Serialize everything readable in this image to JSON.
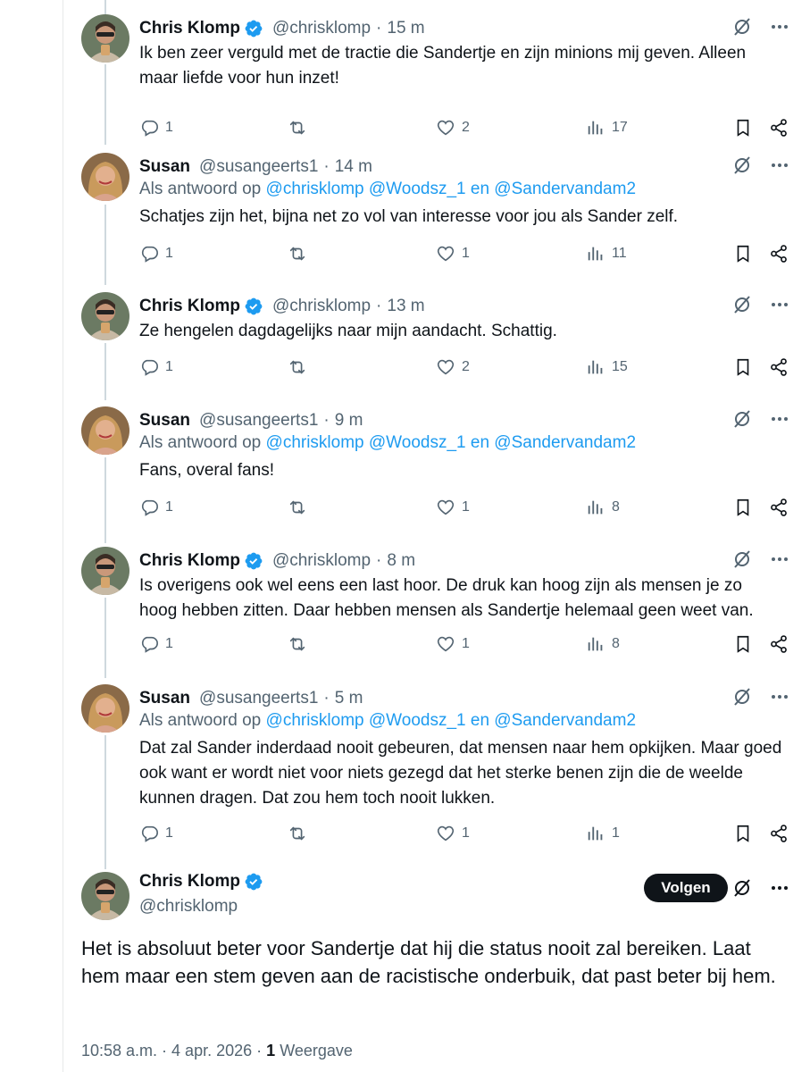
{
  "colors": {
    "accent": "#1d9bf0",
    "text": "#0f1419",
    "muted": "#536471"
  },
  "replies": [
    {
      "name": "Chris Klomp",
      "verified": true,
      "handle": "@chrisklomp",
      "time": "15 m",
      "reply_to": null,
      "text": "Ik ben zeer verguld met de tractie die Sandertje en zijn minions mij geven. Alleen maar liefde voor hun inzet!",
      "replies": "1",
      "reposts": "",
      "likes": "2",
      "views": "17"
    },
    {
      "name": "Susan",
      "verified": false,
      "handle": "@susangeerts1",
      "time": "14 m",
      "reply_to": {
        "prefix": "Als antwoord op",
        "mentions": "@chrisklomp @Woodsz_1 en @Sandervandam2"
      },
      "text": "Schatjes zijn het, bijna net zo vol van interesse voor jou als Sander zelf.",
      "replies": "1",
      "reposts": "",
      "likes": "1",
      "views": "11"
    },
    {
      "name": "Chris Klomp",
      "verified": true,
      "handle": "@chrisklomp",
      "time": "13 m",
      "reply_to": null,
      "text": "Ze hengelen dagdagelijks naar mijn aandacht. Schattig.",
      "replies": "1",
      "reposts": "",
      "likes": "2",
      "views": "15"
    },
    {
      "name": "Susan",
      "verified": false,
      "handle": "@susangeerts1",
      "time": "9 m",
      "reply_to": {
        "prefix": "Als antwoord op",
        "mentions": "@chrisklomp @Woodsz_1 en @Sandervandam2"
      },
      "text": "Fans, overal fans!",
      "replies": "1",
      "reposts": "",
      "likes": "1",
      "views": "8"
    },
    {
      "name": "Chris Klomp",
      "verified": true,
      "handle": "@chrisklomp",
      "time": "8 m",
      "reply_to": null,
      "text": "Is overigens ook wel eens een last hoor. De druk kan hoog zijn als mensen je zo hoog hebben zitten. Daar hebben mensen als Sandertje helemaal geen weet van.",
      "replies": "1",
      "reposts": "",
      "likes": "1",
      "views": "8"
    },
    {
      "name": "Susan",
      "verified": false,
      "handle": "@susangeerts1",
      "time": "5 m",
      "reply_to": {
        "prefix": "Als antwoord op",
        "mentions": "@chrisklomp @Woodsz_1 en @Sandervandam2"
      },
      "text": "Dat zal Sander inderdaad nooit gebeuren, dat mensen naar hem opkijken. Maar goed ook want er wordt niet voor niets gezegd dat het sterke benen zijn die de weelde kunnen dragen. Dat zou hem toch nooit lukken.",
      "replies": "1",
      "reposts": "",
      "likes": "1",
      "views": "1"
    }
  ],
  "main_post": {
    "name": "Chris Klomp",
    "verified": true,
    "handle": "@chrisklomp",
    "follow_label": "Volgen",
    "text": "Het is absoluut beter voor Sandertje dat hij die status nooit zal bereiken. Laat hem maar een stem geven aan de racistische onderbuik, dat past beter bij hem.",
    "timestamp": "10:58 a.m. · 4 apr. 2026",
    "separator": "·",
    "views_count": "1",
    "views_label": "Weergave"
  },
  "icons": {
    "reply": "reply-icon",
    "repost": "repost-icon",
    "like": "like-icon",
    "views": "views-icon",
    "bookmark": "bookmark-icon",
    "share": "share-icon",
    "grok": "grok-icon",
    "more": "more-icon",
    "verified": "verified-badge-icon"
  }
}
